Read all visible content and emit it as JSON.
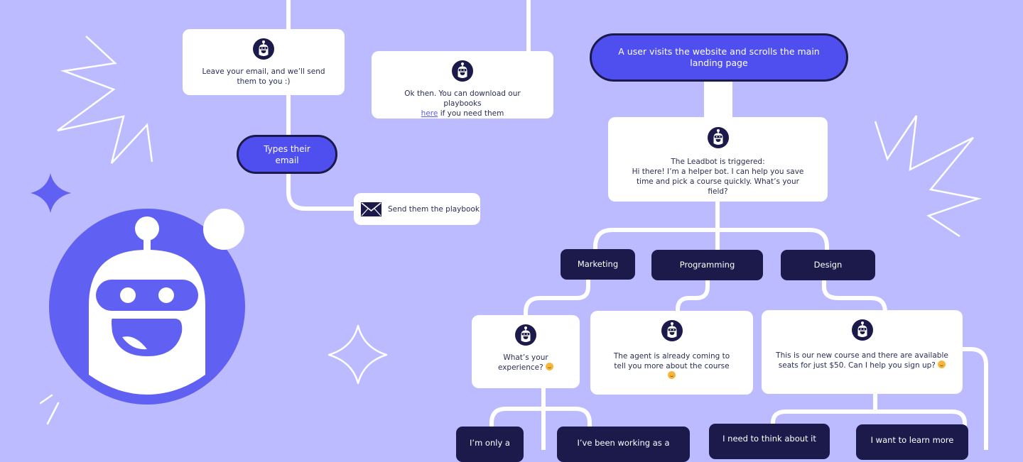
{
  "colors": {
    "background": "#bcbbff",
    "accent": "#4f4ff0",
    "dark_node": "#1b1a4a",
    "card": "#ffffff",
    "connector": "#ffffff",
    "illustration": "#6060f2"
  },
  "start_node": {
    "text": "A user visits the website and scrolls the main landing page"
  },
  "leadbot_card": {
    "icon": "robot-icon",
    "line1": "The Leadbot is triggered:",
    "line2": "Hi there! I’m a helper bot. I can help you save time and pick a course quickly. What’s your field?"
  },
  "field_options": [
    {
      "label": "Marketing"
    },
    {
      "label": "Programming"
    },
    {
      "label": "Design"
    }
  ],
  "marketing_card": {
    "icon": "robot-icon",
    "text": "What’s your experience?",
    "emoji": "smile-emoji"
  },
  "programming_card": {
    "icon": "robot-icon",
    "text": "The agent is already coming to tell you more about the course",
    "emoji": "smile-emoji"
  },
  "design_card": {
    "icon": "robot-icon",
    "text": "This is our new course and there are available seats for just $50. Can I help you sign up?",
    "emoji": "smile-emoji"
  },
  "experience_options": [
    {
      "label": "I’m only a"
    },
    {
      "label": "I’ve been working as a"
    }
  ],
  "design_options": [
    {
      "label": "I need to think about it"
    },
    {
      "label": "I want to learn more"
    }
  ],
  "email_card": {
    "icon": "robot-icon",
    "text": "Leave your email, and we’ll send them to you :)"
  },
  "playbook_card": {
    "icon": "robot-icon",
    "text_before": "Ok then. You can download our playbooks",
    "link": "here",
    "text_after": "if you need them"
  },
  "types_email_node": {
    "text": "Types their email"
  },
  "send_card": {
    "icon": "envelope-icon",
    "text": "Send them the playbook"
  },
  "illustration": {
    "main": "robot-mascot",
    "decorations": [
      "zigzag-left",
      "zigzag-right",
      "sparkle-filled",
      "sparkle-outline",
      "dashes"
    ]
  }
}
